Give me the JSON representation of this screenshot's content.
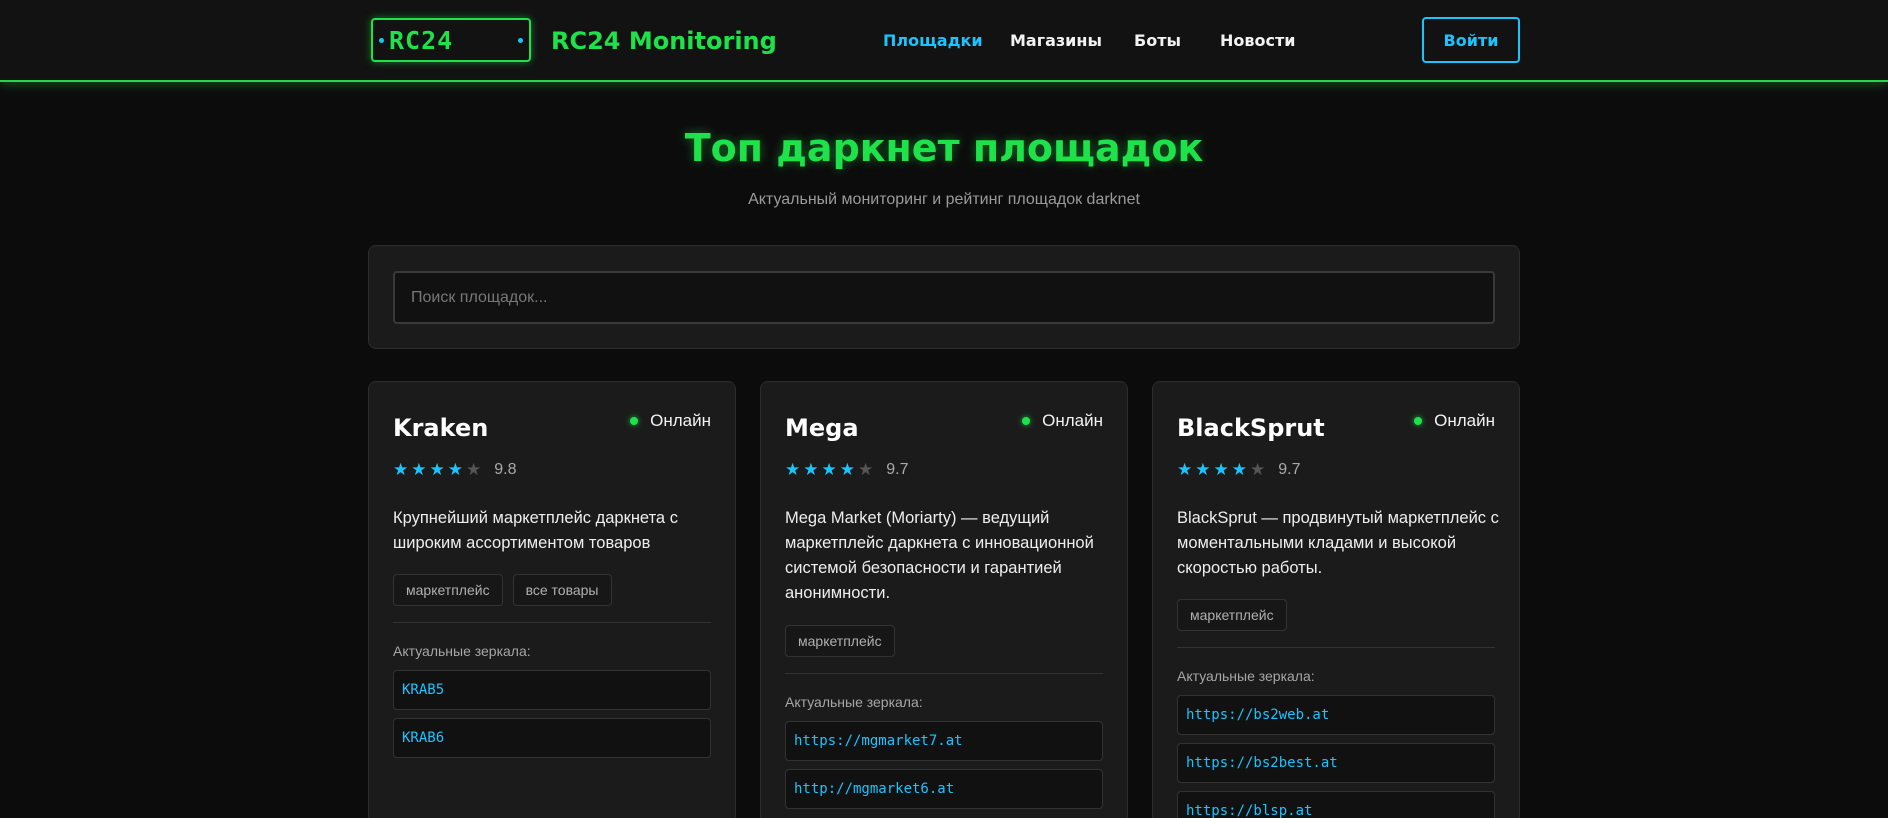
{
  "header": {
    "logo_text": "RC24",
    "brand": "RC24 Monitoring",
    "nav": [
      "Площадки",
      "Магазины",
      "Боты",
      "Новости"
    ],
    "login_label": "Войти"
  },
  "hero": {
    "title": "Топ даркнет площадок",
    "subtitle": "Актуальный мониторинг и рейтинг площадок darknet"
  },
  "search": {
    "placeholder": "Поиск площадок..."
  },
  "colors": {
    "accent_green": "#1ee24a",
    "accent_cyan": "#19c4ff",
    "background": "#0c0c0c",
    "card": "#1b1b1b"
  },
  "cards": [
    {
      "name": "Kraken",
      "status": "Онлайн",
      "stars_filled": 4,
      "stars_total": 5,
      "rating": "9.8",
      "description": "Крупнейший маркетплейс даркнета с широким ассортиментом товаров",
      "tags": [
        "маркетплейс",
        "все товары"
      ],
      "mirrors_label": "Актуальные зеркала:",
      "mirrors": [
        "KRAB5",
        "KRAB6"
      ]
    },
    {
      "name": "Mega",
      "status": "Онлайн",
      "stars_filled": 4,
      "stars_total": 5,
      "rating": "9.7",
      "description": "Mega Market (Moriarty) — ведущий маркетплейс даркнета с инновационной системой безопасности и гарантией анонимности.",
      "tags": [
        "маркетплейс"
      ],
      "mirrors_label": "Актуальные зеркала:",
      "mirrors": [
        "https://mgmarket7.at",
        "http://mgmarket6.at"
      ]
    },
    {
      "name": "BlackSprut",
      "status": "Онлайн",
      "stars_filled": 4,
      "stars_total": 5,
      "rating": "9.7",
      "description": "BlackSprut — продвинутый маркетплейс с моментальными кладами и высокой скоростью работы.",
      "tags": [
        "маркетплейс"
      ],
      "mirrors_label": "Актуальные зеркала:",
      "mirrors": [
        "https://bs2web.at",
        "https://bs2best.at",
        "https://blsp.at"
      ]
    }
  ]
}
